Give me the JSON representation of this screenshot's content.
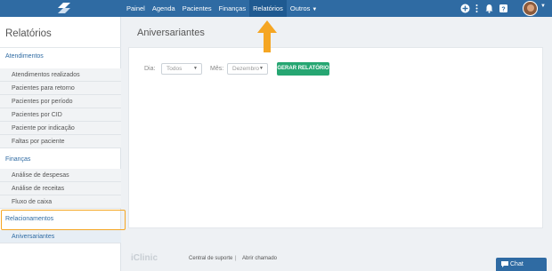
{
  "nav": {
    "items": [
      "Painel",
      "Agenda",
      "Pacientes",
      "Finanças",
      "Relatórios",
      "Outros"
    ],
    "outros_caret": "▼"
  },
  "sidebar": {
    "title": "Relatórios",
    "sections": [
      {
        "heading": "Atendimentos",
        "items": [
          "Atendimentos realizados",
          "Pacientes para retorno",
          "Pacientes por período",
          "Pacientes por CID",
          "Paciente por indicação",
          "Faltas por paciente"
        ]
      },
      {
        "heading": "Finanças",
        "items": [
          "Análise de despesas",
          "Análise de receitas",
          "Fluxo de caixa"
        ]
      },
      {
        "heading": "Relacionamentos",
        "items": [
          "Aniversariantes"
        ]
      }
    ]
  },
  "main": {
    "title": "Aniversariantes",
    "filters": {
      "dia_label": "Dia:",
      "dia_value": "Todos",
      "mes_label": "Mês:",
      "mes_value": "Dezembro",
      "generate_button": "GERAR RELATÓRIO"
    }
  },
  "footer": {
    "logo": "iClinic",
    "support_link": "Central de suporte",
    "separator": "|",
    "ticket_link": "Abrir chamado"
  },
  "chat": {
    "label": "Chat"
  },
  "colors": {
    "primary": "#2f6ba3",
    "success": "#26a672",
    "highlight": "#f5a623"
  }
}
